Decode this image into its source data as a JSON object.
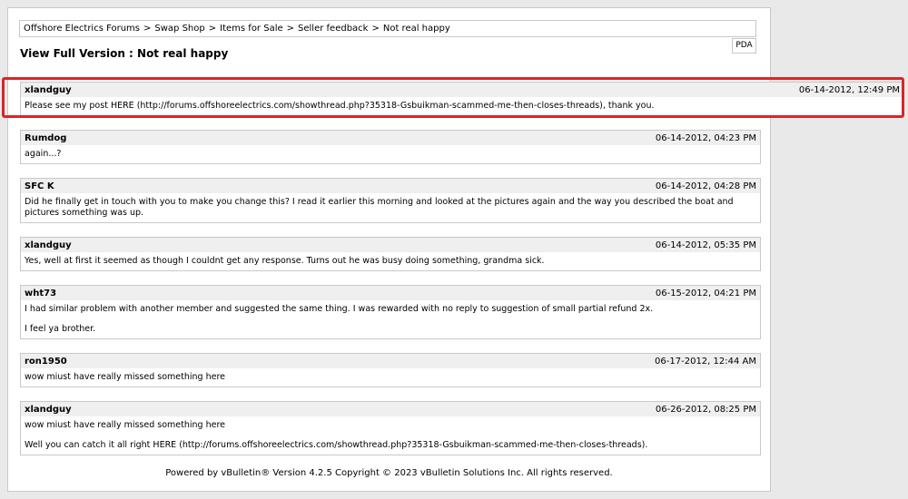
{
  "breadcrumb": {
    "items": [
      "Offshore Electrics Forums",
      "Swap Shop",
      "Items for Sale",
      "Seller feedback",
      "Not real happy"
    ],
    "separator": ">"
  },
  "pda_label": "PDA",
  "page_title": "View Full Version : Not real happy",
  "posts": [
    {
      "user": "xlandguy",
      "date": "06-14-2012, 12:49 PM",
      "body": [
        "Please see my post HERE (http://forums.offshoreelectrics.com/showthread.php?35318-Gsbuikman-scammed-me-then-closes-threads), thank you."
      ]
    },
    {
      "user": "Rumdog",
      "date": "06-14-2012, 04:23 PM",
      "body": [
        "again...?"
      ]
    },
    {
      "user": "SFC K",
      "date": "06-14-2012, 04:28 PM",
      "body": [
        "Did he finally get in touch with you to make you change this? I read it earlier this morning and looked at the pictures again and the way you described the boat and pictures something was up."
      ]
    },
    {
      "user": "xlandguy",
      "date": "06-14-2012, 05:35 PM",
      "body": [
        "Yes, well at first it seemed as though I couldnt get any response. Turns out he was busy doing something, grandma sick."
      ]
    },
    {
      "user": "wht73",
      "date": "06-15-2012, 04:21 PM",
      "body": [
        "I had similar problem with another member and suggested the same thing. I was rewarded with no reply to suggestion of small partial refund 2x.",
        "I feel ya brother."
      ]
    },
    {
      "user": "ron1950",
      "date": "06-17-2012, 12:44 AM",
      "body": [
        "wow miust have really missed something here"
      ]
    },
    {
      "user": "xlandguy",
      "date": "06-26-2012, 08:25 PM",
      "body": [
        "wow miust have really missed something here",
        "Well you can catch it all right HERE (http://forums.offshoreelectrics.com/showthread.php?35318-Gsbuikman-scammed-me-then-closes-threads)."
      ]
    }
  ],
  "footer": "Powered by vBulletin® Version 4.2.5 Copyright © 2023 vBulletin Solutions Inc. All rights reserved."
}
